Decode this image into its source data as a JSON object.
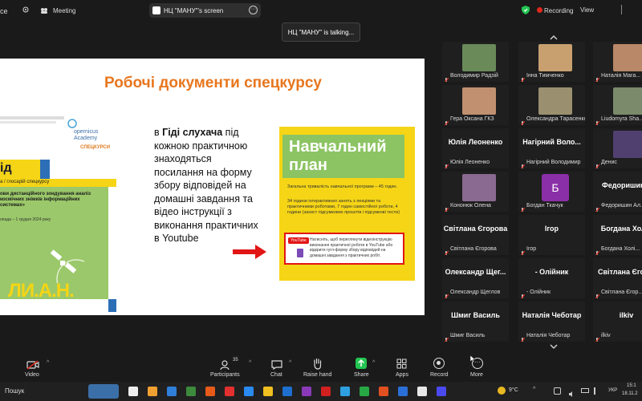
{
  "topbar": {
    "app_fragment": "ce",
    "meeting_label": "Meeting",
    "screen_title": "НЦ \"МАНУ\"'s screen",
    "recording": "Recording",
    "view": "View"
  },
  "talking": "НЦ \"МАНУ\" is talking...",
  "slide": {
    "title": "Робочі документи спецкурсу",
    "body_prefix": "в ",
    "body_bold": "Гіді слухача",
    "body_rest": " під кожною практичною знаходяться посилання на форму збору відповідей на домашні завдання та відео інструкції з виконання практичних в Youtube",
    "plan_title": "Навчальний план",
    "plan_text1": "Загальна тривалість навчальної програми – 45 годин.",
    "plan_text2": "34 години інтерактивних занять з лекціями та практичними роботами, 7 годин самостійної роботи, 4 години (захист підсумкових проєктів і підсумкові тести)",
    "plan_note": "Натисніть, щоб переглянути відеоінструкцію виконання практичної роботи в YouTube або відкрити гугл-форму збору відповідей на домашні завдання з практичних робіт.",
    "youtube": "YouTube",
    "guide_logo": "opernicus Academy",
    "guide_logo2": "СПЕЦКУРСИ",
    "guide_title": "ід",
    "guide_sub": "а / глоcарій спецкурсу",
    "guide_text": "ови дистанційного зондування аналіз космічних знімків інформаційних системах»",
    "guide_date": "опада – 1 грудня 2024 року",
    "man_logo": "ЛИ.А.Н."
  },
  "participants": [
    {
      "name": "Володимир Радзій",
      "type": "photo",
      "color": "#6a8a5a"
    },
    {
      "name": "Інна Тимченко",
      "type": "photo",
      "color": "#c8a070"
    },
    {
      "name": "Наталія Мага...",
      "type": "photo",
      "color": "#b88868"
    },
    {
      "name": "Гера Оксана ГКЗ",
      "type": "photo",
      "color": "#c09070"
    },
    {
      "name": "Олександра Тарасенко",
      "type": "photo",
      "color": "#9a9070"
    },
    {
      "name": "Liudomyra Sha...",
      "type": "photo",
      "color": "#7a8a6a"
    },
    {
      "name": "Юлія Леоненко",
      "type": "big",
      "big": "Юлія Леоненко"
    },
    {
      "name": "Нагірний Володимир",
      "type": "big",
      "big": "Нагірний Воло..."
    },
    {
      "name": "Денис",
      "type": "photo",
      "color": "#504070"
    },
    {
      "name": "Кононюк Олена",
      "type": "photo",
      "color": "#8a6a90"
    },
    {
      "name": "Богдан Ткачук",
      "type": "avatar",
      "big": "Б",
      "color": "#8b2fa8"
    },
    {
      "name": "Федоришин Ал...",
      "type": "big",
      "big": "Федоришин..."
    },
    {
      "name": "Світлана Єгорова",
      "type": "big",
      "big": "Світлана Єгорова"
    },
    {
      "name": "Ігор",
      "type": "big",
      "big": "Ігор"
    },
    {
      "name": "Богдана Холі...",
      "type": "big",
      "big": "Богдана Хол..."
    },
    {
      "name": "Олександр Щеглов",
      "type": "big",
      "big": "Олександр Щег..."
    },
    {
      "name": "- Олійник",
      "type": "big",
      "big": "- Олійник"
    },
    {
      "name": "Світлана Єгор...",
      "type": "big",
      "big": "Світлана Єгор..."
    },
    {
      "name": "Шмиг Василь",
      "type": "big",
      "big": "Шмиг Василь"
    },
    {
      "name": "Наталія Чеботар",
      "type": "big",
      "big": "Наталія Чеботар"
    },
    {
      "name": "ilkiv",
      "type": "big",
      "big": "ilkiv"
    }
  ],
  "toolbar": {
    "video": "Video",
    "participants": "Participants",
    "participants_count": "35",
    "chat": "Chat",
    "raise_hand": "Raise hand",
    "share": "Share",
    "apps": "Apps",
    "record": "Record",
    "more": "More"
  },
  "taskbar": {
    "search": "Пошук",
    "weather": "9°C",
    "lang": "УКР",
    "time": "15:1",
    "date": "18.11.2"
  }
}
